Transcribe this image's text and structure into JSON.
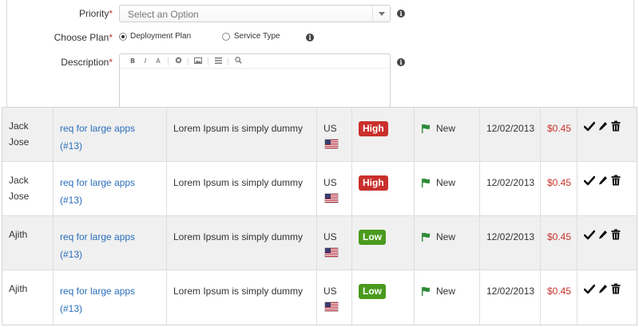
{
  "form": {
    "priority": {
      "label": "Priority",
      "required": "*",
      "placeholder": "Select an Option"
    },
    "plan": {
      "label": "Choose Plan",
      "required": "*",
      "options": [
        {
          "label": "Deployment Plan",
          "selected": true
        },
        {
          "label": "Service Type",
          "selected": false
        }
      ]
    },
    "description": {
      "label": "Description",
      "required": "*",
      "toolbar": [
        "B",
        "I",
        "A",
        "link",
        "image",
        "list",
        "search"
      ]
    }
  },
  "table": {
    "rows": [
      {
        "name": "Jack\nJose",
        "request": "req for large apps (#13)",
        "description": "Lorem Ipsum is simply dummy",
        "country": "US",
        "priority": "High",
        "status": "New",
        "date": "12/02/2013",
        "price": "$0.45"
      },
      {
        "name": "Jack\nJose",
        "request": "req for large apps (#13)",
        "description": "Lorem Ipsum is simply dummy",
        "country": "US",
        "priority": "High",
        "status": "New",
        "date": "12/02/2013",
        "price": "$0.45"
      },
      {
        "name": "Ajith",
        "request": "req for large apps (#13)",
        "description": "Lorem Ipsum is simply dummy",
        "country": "US",
        "priority": "Low",
        "status": "New",
        "date": "12/02/2013",
        "price": "$0.45"
      },
      {
        "name": "Ajith",
        "request": "req for large apps (#13)",
        "description": "Lorem Ipsum is simply dummy",
        "country": "US",
        "priority": "Low",
        "status": "New",
        "date": "12/02/2013",
        "price": "$0.45"
      }
    ]
  },
  "colors": {
    "high": "#c9302c",
    "low": "#4a9a1e",
    "status_flag": "#2e8b3a",
    "price": "#c8332b",
    "link": "#2a6ebb"
  },
  "icons": {
    "info": "info-icon",
    "approve": "check-icon",
    "edit": "pencil-icon",
    "delete": "trash-icon",
    "status": "flag-icon",
    "country": "us-flag-icon"
  }
}
